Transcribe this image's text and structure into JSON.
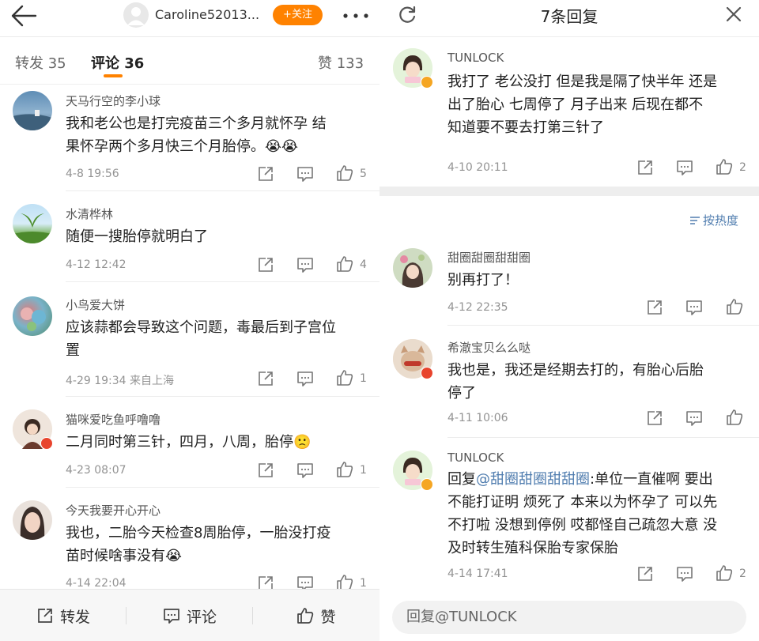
{
  "left": {
    "header": {
      "username": "Caroline52013...",
      "follow_label": "+关注"
    },
    "tabs": {
      "repost_label": "转发",
      "repost_count": "35",
      "comment_label": "评论",
      "comment_count": "36",
      "like_label": "赞",
      "like_count": "133"
    },
    "comments": [
      {
        "user": "天马行空的李小球",
        "line1": "我和老公也是打完疫苗三个多月就怀孕 结",
        "line2": "果怀孕两个多月快三个月胎停。😭😭",
        "time": "4-8 19:56",
        "likes": "5"
      },
      {
        "user": "水清桦林",
        "line1": "随便一搜胎停就明白了",
        "line2": "",
        "time": "4-12 12:42",
        "likes": "4"
      },
      {
        "user": "小鸟爱大饼",
        "line1": "应该蒜都会导致这个问题，毒最后到子宫位",
        "line2": "置",
        "time": "4-29 19:34 来自上海",
        "likes": "1"
      },
      {
        "user": "猫咪爱吃鱼呼噜噜",
        "line1": "二月同时第三针，四月，八周，胎停🙁",
        "line2": "",
        "time": "4-23 08:07",
        "likes": "1"
      },
      {
        "user": "今天我要开心开心",
        "line1": "我也，二胎今天检查8周胎停，一胎没打疫",
        "line2": "苗时候啥事没有😭",
        "time": "4-14 22:04",
        "likes": "1"
      }
    ],
    "bottom": {
      "repost": "转发",
      "comment": "评论",
      "like": "赞"
    }
  },
  "right": {
    "title": "7条回复",
    "main": {
      "user": "TUNLOCK",
      "line1": "我打了 老公没打 但是我是隔了快半年 还是",
      "line2": "出了胎心 七周停了 月子出来  后现在都不",
      "line3": "知道要不要去打第三针了",
      "time": "4-10 20:11",
      "likes": "2"
    },
    "sort_label": "按热度",
    "replies": [
      {
        "user": "甜圈甜圈甜甜圈",
        "line1": "别再打了！",
        "line2": "",
        "time": "4-12 22:35",
        "likes": ""
      },
      {
        "user": "希澈宝贝么么哒",
        "line1": "我也是，我还是经期去打的，有胎心后胎",
        "line2": "停了",
        "time": "4-11 10:06",
        "likes": ""
      }
    ],
    "last": {
      "user": "TUNLOCK",
      "prefix": "回复",
      "mention": "@甜圈甜圈甜甜圈",
      "line1_rest": ":单位一直催啊 要出",
      "line2": "不能打证明 烦死了 本来以为怀孕了 可以先",
      "line3": "不打啦 没想到停例 哎都怪自己疏忽大意 没",
      "line4": "及时转生殖科保胎专家保胎",
      "time": "4-14 17:41",
      "likes": "2"
    },
    "reply_placeholder": "回复@TUNLOCK"
  }
}
